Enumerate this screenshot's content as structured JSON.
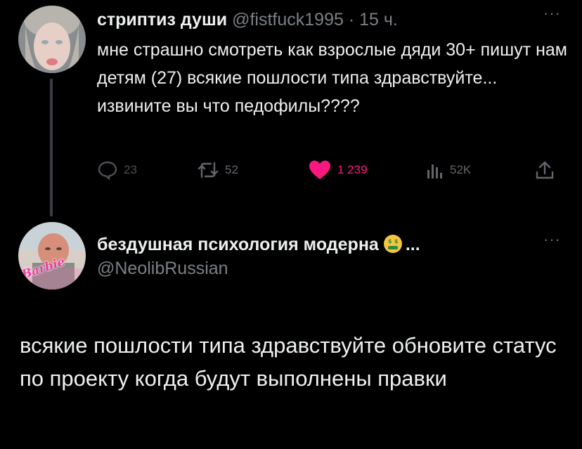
{
  "tweet1": {
    "display_name": "стриптиз души",
    "handle": "@fistfuck1995",
    "separator": "·",
    "time": "15 ч.",
    "more": "···",
    "text": "мне страшно смотреть как взрослые дяди 30+ пишут нам детям (27) всякие пошлости типа здравствуйте... извините вы что педофилы????",
    "replies": "23",
    "retweets": "52",
    "likes": "1 239",
    "views": "52K",
    "like_color": "#f91880"
  },
  "tweet2": {
    "display_name": "бездушная психология модерна",
    "emoji": "money-mouth-face",
    "ellipsis": "...",
    "handle": "@NeolibRussian",
    "more": "···",
    "avatar_badge": "Barbie",
    "text": "всякие пошлости типа здравствуйте обновите статус по проекту когда будут выполнены правки"
  }
}
